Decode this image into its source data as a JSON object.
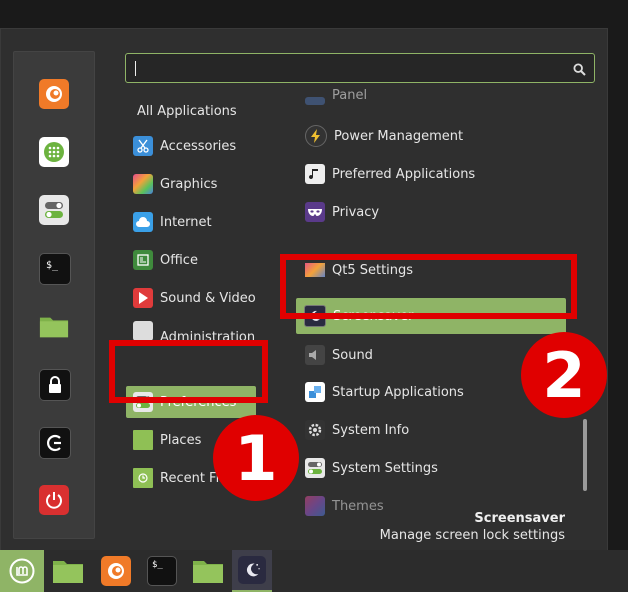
{
  "search": {
    "value": "",
    "placeholder": ""
  },
  "categories": [
    {
      "label": "All Applications"
    },
    {
      "label": "Accessories"
    },
    {
      "label": "Graphics"
    },
    {
      "label": "Internet"
    },
    {
      "label": "Office"
    },
    {
      "label": "Sound & Video"
    },
    {
      "label": "Administration"
    },
    {
      "label": "Preferences"
    },
    {
      "label": "Places"
    },
    {
      "label": "Recent Fil"
    }
  ],
  "apps": [
    {
      "label": "Panel"
    },
    {
      "label": "Power Management"
    },
    {
      "label": "Preferred Applications"
    },
    {
      "label": "Privacy"
    },
    {
      "label": "Qt5 Settings"
    },
    {
      "label": "Screensaver"
    },
    {
      "label": "Sound"
    },
    {
      "label": "Startup Applications"
    },
    {
      "label": "System Info"
    },
    {
      "label": "System Settings"
    },
    {
      "label": "Themes"
    }
  ],
  "description": {
    "title": "Screensaver",
    "text": "Manage screen lock settings"
  },
  "badges": {
    "one": "1",
    "two": "2"
  },
  "colors": {
    "accent": "#8fb466",
    "highlight": "#e00000",
    "panel": "#2f2f2f"
  }
}
